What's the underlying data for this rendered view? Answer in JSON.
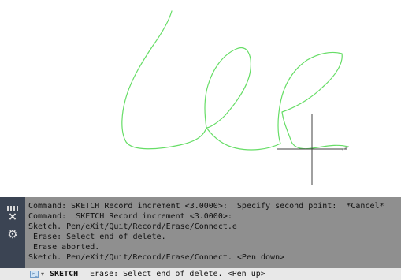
{
  "drawing": {
    "background": "#ffffff",
    "sketch_color": "#66dd66",
    "cursor_color": "#404040",
    "snap_line_color": "#999999"
  },
  "command_history": {
    "lines": [
      "Command: SKETCH Record increment <3.0000>:  Specify second point:  *Cancel*",
      "Command:  SKETCH Record increment <3.0000>:",
      "Sketch. Pen/eXit/Quit/Record/Erase/Connect.e",
      " Erase: Select end of delete.",
      " Erase aborted.",
      "Sketch. Pen/eXit/Quit/Record/Erase/Connect. <Pen down>"
    ]
  },
  "sidebar": {
    "close_icon": "close-icon",
    "settings_icon": "gear-icon",
    "grip_icon": "grip-icon"
  },
  "command_line": {
    "command": "SKETCH",
    "prompt": "Erase: Select end of delete. <Pen up>"
  }
}
